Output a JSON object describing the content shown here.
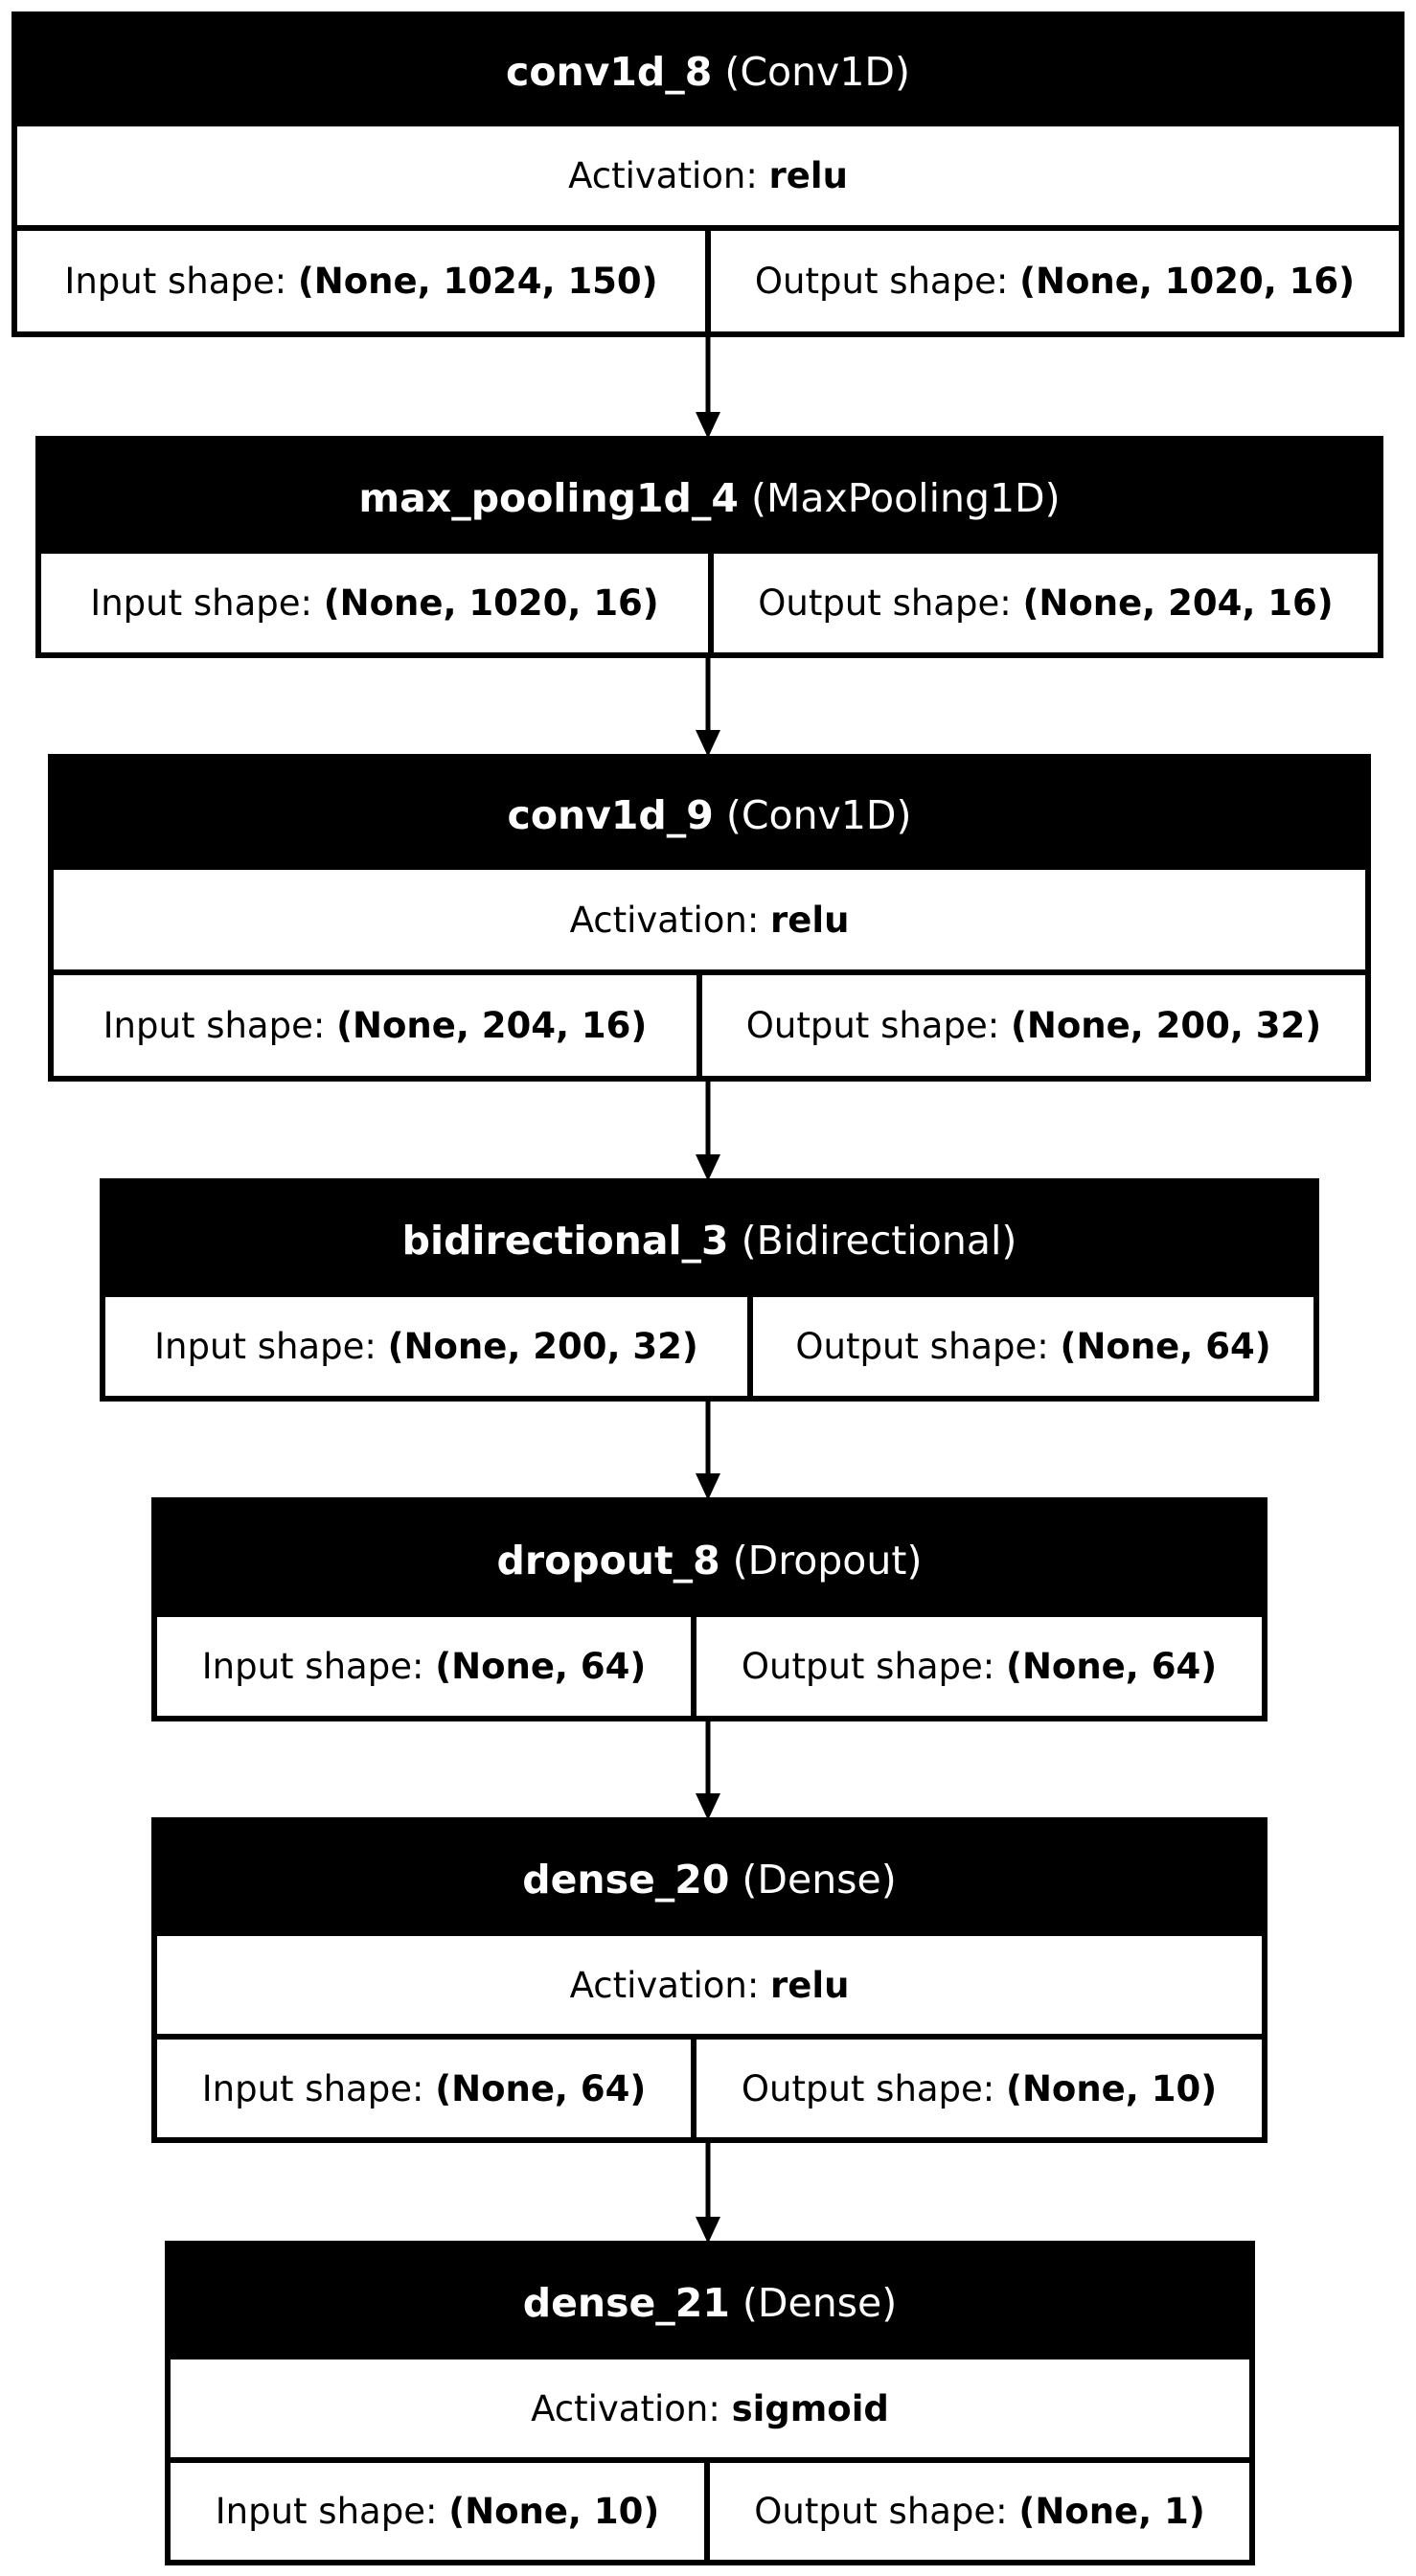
{
  "labels": {
    "activation_prefix": "Activation:",
    "input_prefix": "Input shape:",
    "output_prefix": "Output shape:"
  },
  "layers": [
    {
      "name": "conv1d_8",
      "type": "(Conv1D)",
      "activation": "relu",
      "input_shape": "(None, 1024, 150)",
      "output_shape": "(None, 1020, 16)"
    },
    {
      "name": "max_pooling1d_4",
      "type": "(MaxPooling1D)",
      "activation": null,
      "input_shape": "(None, 1020, 16)",
      "output_shape": "(None, 204, 16)"
    },
    {
      "name": "conv1d_9",
      "type": "(Conv1D)",
      "activation": "relu",
      "input_shape": "(None, 204, 16)",
      "output_shape": "(None, 200, 32)"
    },
    {
      "name": "bidirectional_3",
      "type": "(Bidirectional)",
      "activation": null,
      "input_shape": "(None, 200, 32)",
      "output_shape": "(None, 64)"
    },
    {
      "name": "dropout_8",
      "type": "(Dropout)",
      "activation": null,
      "input_shape": "(None, 64)",
      "output_shape": "(None, 64)"
    },
    {
      "name": "dense_20",
      "type": "(Dense)",
      "activation": "relu",
      "input_shape": "(None, 64)",
      "output_shape": "(None, 10)"
    },
    {
      "name": "dense_21",
      "type": "(Dense)",
      "activation": "sigmoid",
      "input_shape": "(None, 10)",
      "output_shape": "(None, 1)"
    }
  ]
}
